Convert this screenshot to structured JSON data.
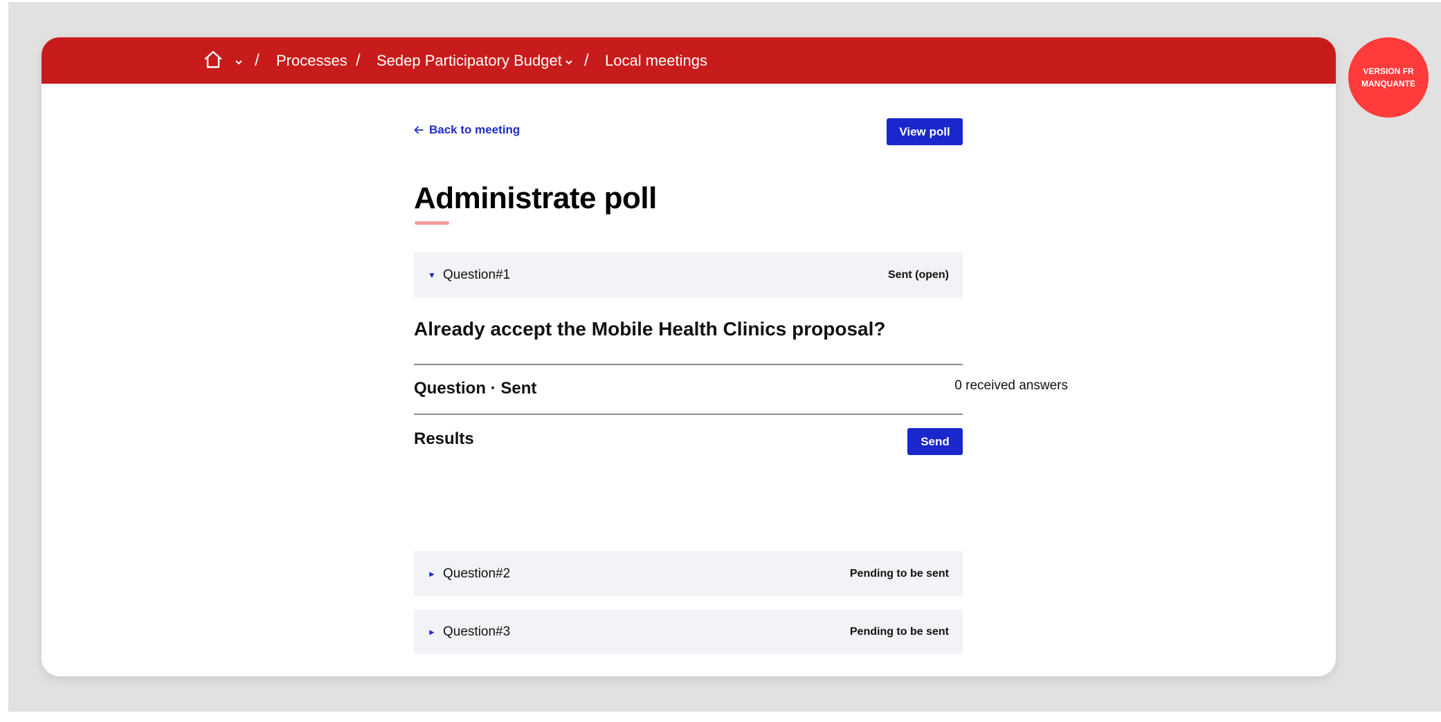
{
  "breadcrumb": {
    "processes": "Processes",
    "process_name": "Sedep Participatory Budget",
    "current": "Local meetings",
    "separator": "/"
  },
  "icons": {
    "home": "home-icon",
    "dropdown": "chevron-down-icon",
    "back": "arrow-left-icon",
    "expanded": "triangle-down-icon",
    "collapsed": "triangle-right-icon"
  },
  "badge": {
    "label": "VERSION FR MANQUANTE"
  },
  "colors": {
    "topbar": "#c81b1b",
    "accent": "#1a27cc",
    "badge": "#ff3b3b",
    "title_underline": "#f39a9a"
  },
  "main": {
    "back_label": "Back to meeting",
    "view_poll_label": "View poll",
    "title": "Administrate poll"
  },
  "questions": [
    {
      "label": "Question#1",
      "status": "Sent (open)",
      "expanded": true,
      "body": "Already accept the Mobile Health Clinics proposal?",
      "state_heading": "Question · Sent",
      "answers": "0 received answers",
      "results_heading": "Results",
      "send_label": "Send"
    },
    {
      "label": "Question#2",
      "status": "Pending to be sent",
      "expanded": false
    },
    {
      "label": "Question#3",
      "status": "Pending to be sent",
      "expanded": false
    }
  ],
  "glyphs": {
    "expanded": "▼",
    "collapsed": "►"
  }
}
